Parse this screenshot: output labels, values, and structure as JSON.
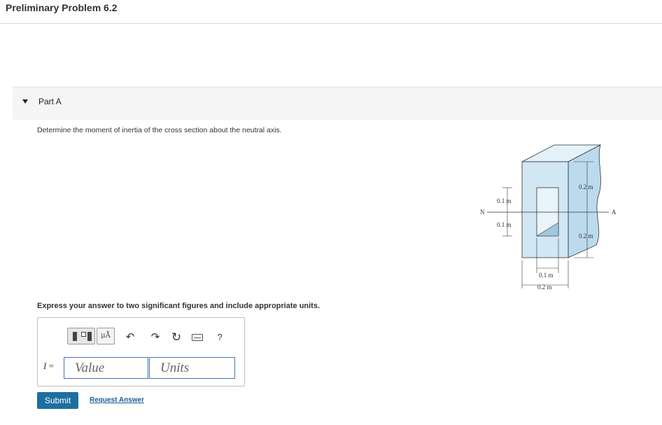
{
  "page": {
    "title": "Preliminary Problem 6.2"
  },
  "part": {
    "label": "Part A"
  },
  "question": "Determine the moment of inertia of the cross section about the neutral axis.",
  "instruction": "Express your answer to two significant figures and include appropriate units.",
  "answer": {
    "label_symbol": "I",
    "label_equals": " =",
    "value_placeholder": "Value",
    "units_placeholder": "Units",
    "units_button": "μÅ",
    "help_button": "?"
  },
  "actions": {
    "submit": "Submit",
    "request_answer": "Request Answer"
  },
  "figure": {
    "labels": {
      "top_right": "0.2 m",
      "bottom_right": "0.2 m",
      "left_top": "0.1 m",
      "left_bottom": "0.1 m",
      "bottom_inner": "0.1 m",
      "bottom_outer": "0.2 m",
      "axis_left": "N",
      "axis_right": "A"
    },
    "colors": {
      "block_front": "#d1e7f4",
      "block_side": "#bcdaee",
      "block_top": "#e3f1f9"
    }
  }
}
